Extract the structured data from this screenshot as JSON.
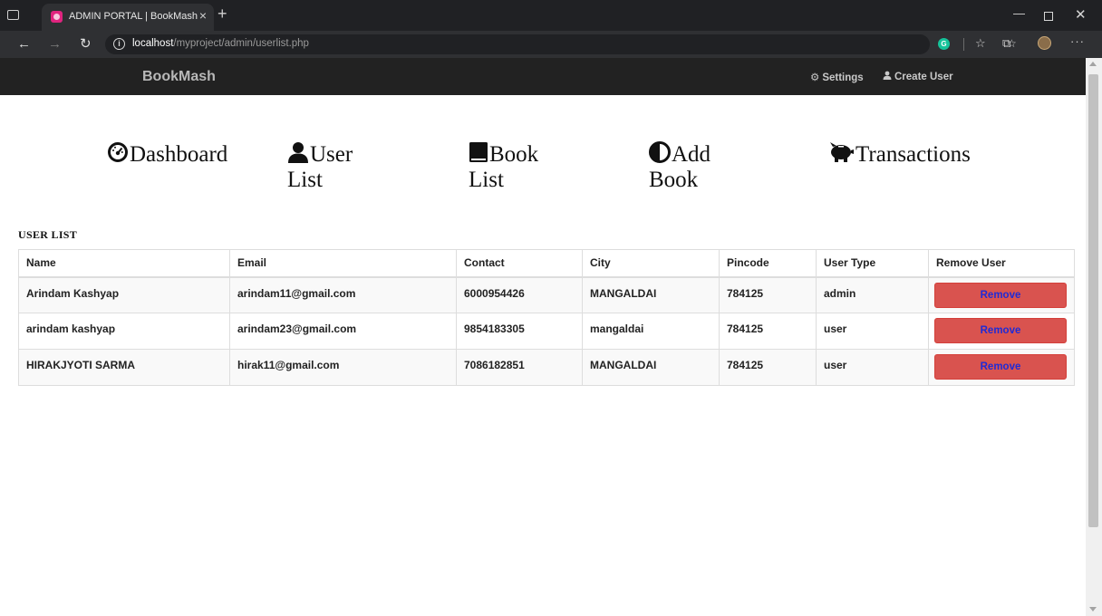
{
  "browser": {
    "tab_title": "ADMIN PORTAL | BookMash",
    "url_host": "localhost",
    "url_path": "/myproject/admin/userlist.php"
  },
  "navbar": {
    "brand": "BookMash",
    "settings": "Settings",
    "create_user": "Create User"
  },
  "menu": {
    "dashboard": "Dashboard",
    "user_list": "User List",
    "book_list": "Book List",
    "add_book": "Add Book",
    "transactions": "Transactions"
  },
  "section_title": "USER LIST",
  "table": {
    "headers": [
      "Name",
      "Email",
      "Contact",
      "City",
      "Pincode",
      "User Type",
      "Remove User"
    ],
    "rows": [
      [
        "Arindam Kashyap",
        "arindam11@gmail.com",
        "6000954426",
        "MANGALDAI",
        "784125",
        "admin"
      ],
      [
        "arindam kashyap",
        "arindam23@gmail.com",
        "9854183305",
        "mangaldai",
        "784125",
        "user"
      ],
      [
        "HIRAKJYOTI SARMA",
        "hirak11@gmail.com",
        "7086182851",
        "MANGALDAI",
        "784125",
        "user"
      ]
    ],
    "remove_label": "Remove"
  },
  "colors": {
    "navbar_bg": "#222222",
    "remove_button": "#d9534f",
    "remove_text": "#1f2bd6"
  }
}
